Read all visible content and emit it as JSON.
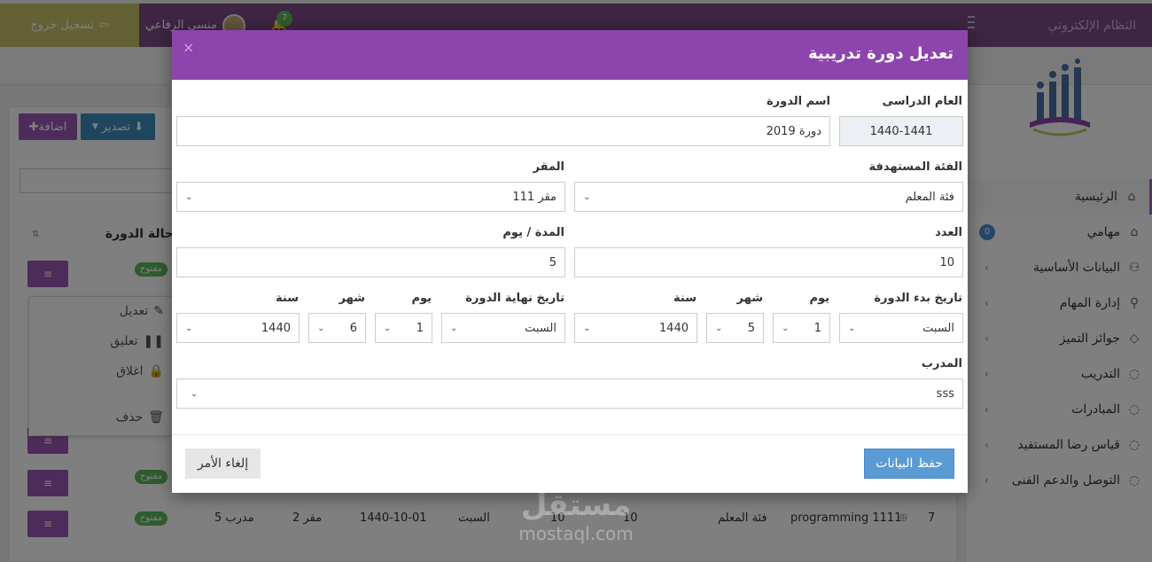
{
  "header": {
    "brand": "النظام الإلكتروني",
    "logout": "تسجيل خروج",
    "user_name": "منسي الرفاعي",
    "notif_count": "7"
  },
  "sidebar": {
    "items": [
      {
        "label": "الرئيسية",
        "icon": "home-icon"
      },
      {
        "label": "مهامي",
        "icon": "home-icon",
        "badge": "0"
      },
      {
        "label": "البيانات الأساسية",
        "icon": "users-icon"
      },
      {
        "label": "إدارة المهام",
        "icon": "search-icon"
      },
      {
        "label": "جوائز التميز",
        "icon": "diamond-icon"
      },
      {
        "label": "التدريب",
        "icon": "chat-icon"
      },
      {
        "label": "المبادرات",
        "icon": "chat-icon"
      },
      {
        "label": "قياس رضا المستفيد",
        "icon": "chat-icon"
      },
      {
        "label": "التوصل والدعم الفنى",
        "icon": "chat-icon"
      }
    ]
  },
  "toolbar": {
    "add": "اضافة",
    "export": "تصدير"
  },
  "table": {
    "status_header": "حالة الدورة",
    "open_badge": "مفتوح",
    "menu": [
      "تعديل",
      "تعليق",
      "اغلاق",
      "حذف"
    ],
    "last_row": {
      "num": "7",
      "name": "programming 1111",
      "category": "فئة المعلم",
      "count": "10",
      "days": "10",
      "day": "السبت",
      "end_date": "1440-10-01",
      "location": "مقر 2",
      "trainer": "مدرب 5"
    }
  },
  "watermark": {
    "ar": "مستقل",
    "en": "mostaql.com"
  },
  "modal": {
    "title": "تعديل دورة تدريبية",
    "close": "×",
    "labels": {
      "year": "العام الدراسى",
      "name": "اسم الدورة",
      "category": "الفئة المستهدفة",
      "location": "المقر",
      "count": "العدد",
      "duration": "المدة / يوم",
      "start": "تاريخ بدء الدورة",
      "end": "تاريخ نهاية الدورة",
      "day": "يوم",
      "month": "شهر",
      "yearpart": "سنة",
      "trainer": "المدرب"
    },
    "values": {
      "year": "1440-1441",
      "name": "دورة 2019",
      "category": "فئة المعلم",
      "location": "مقر 111",
      "count": "10",
      "duration": "5",
      "start_dayname": "السبت",
      "start_day": "1",
      "start_month": "5",
      "start_year": "1440",
      "end_dayname": "السبت",
      "end_day": "1",
      "end_month": "6",
      "end_year": "1440",
      "trainer": "sss"
    },
    "save": "حفظ البيانات",
    "cancel": "إلغاء الأمر"
  }
}
